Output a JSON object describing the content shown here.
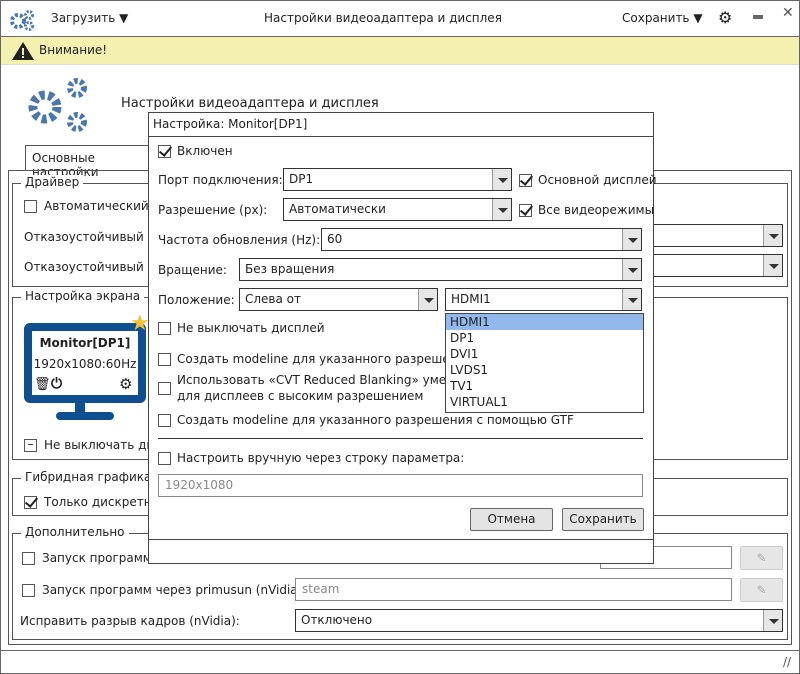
{
  "titlebar": {
    "load_label": "Загрузить",
    "title": "Настройки видеоадаптера и дисплея",
    "save_label": "Сохранить"
  },
  "warning": {
    "text": "Внимание!"
  },
  "header": {
    "title": "Настройки видеоадаптера и дисплея"
  },
  "tabs": [
    {
      "label": "Основные настройки"
    }
  ],
  "driver": {
    "legend": "Драйвер",
    "auto_label": "Автоматический в",
    "fallback1_label": "Отказоустойчивый др",
    "fallback2_label": "Отказоустойчивый др"
  },
  "screen": {
    "legend": "Настройка экрана",
    "monitor_name": "Monitor[DP1]",
    "monitor_mode": "1920x1080:60Hz",
    "keep_on_label": "Не выключать ди"
  },
  "hybrid": {
    "legend": "Гибридная графика",
    "discrete_label": "Только дискретно"
  },
  "extra": {
    "legend": "Дополнительно",
    "run1_label": "Запуск программ ч",
    "run2_label": "Запуск программ через primusun (nVidia):",
    "run2_value": "steam",
    "tearing_label": "Исправить разрыв кадров (nVidia):",
    "tearing_value": "Отключено"
  },
  "dialog": {
    "title": "Настройка: Monitor[DP1]",
    "enabled_label": "Включен",
    "port_label": "Порт подключения:",
    "port_value": "DP1",
    "primary_label": "Основной дисплей",
    "res_label": "Разрешение (px):",
    "res_value": "Автоматически",
    "allmodes_label": "Все видеорежимы",
    "rate_label": "Частота обновления (Hz):",
    "rate_value": "60",
    "rot_label": "Вращение:",
    "rot_value": "Без вращения",
    "pos_label": "Положение:",
    "pos_value": "Слева от",
    "pos_target": "HDMI1",
    "pos_options": [
      "HDMI1",
      "DP1",
      "DVI1",
      "LVDS1",
      "TV1",
      "VIRTUAL1"
    ],
    "opt_keep_on": "Не выключать дисплей",
    "opt_modeline": "Создать modeline для указанного разрешения",
    "opt_cvt_1": "Использовать «CVT Reduced Blanking» умен",
    "opt_cvt_2": "для дисплеев с высоким разрешением",
    "opt_gtf": "Создать modeline для указанного разрешения с помощью GTF",
    "manual_label": "Настроить вручную через строку параметра:",
    "manual_placeholder": "1920x1080",
    "cancel_label": "Отмена",
    "save_label": "Сохранить"
  },
  "colors": {
    "accent": "#4a78ad",
    "monitor": "#0d4f91",
    "warning_bg": "#f3f0b0",
    "selection": "#92b8ec",
    "star": "#f2c230"
  }
}
